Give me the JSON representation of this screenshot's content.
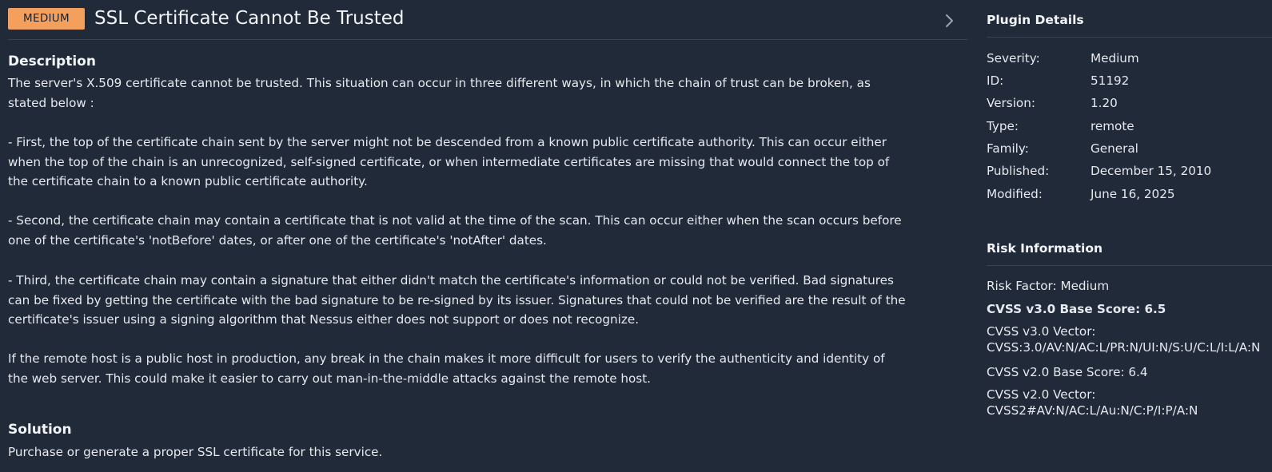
{
  "header": {
    "severity_badge": "MEDIUM",
    "title": "SSL Certificate Cannot Be Trusted",
    "colors": {
      "background": "#212a38",
      "badge": "#f3a05e",
      "divider": "#3a4454"
    },
    "next_icon": "chevron-right-icon"
  },
  "description": {
    "heading": "Description",
    "paragraphs": [
      "The server's X.509 certificate cannot be trusted. This situation can occur in three different ways, in which the chain of trust can be broken, as stated below :",
      "- First, the top of the certificate chain sent by the server might not be descended from a known public certificate authority. This can occur either when the top of the chain is an unrecognized, self-signed certificate, or when intermediate certificates are missing that would connect the top of the certificate chain to a known public certificate authority.",
      "- Second, the certificate chain may contain a certificate that is not valid at the time of the scan. This can occur either when the scan occurs before one of the certificate's 'notBefore' dates, or after one of the certificate's 'notAfter' dates.",
      "- Third, the certificate chain may contain a signature that either didn't match the certificate's information or could not be verified. Bad signatures can be fixed by getting the certificate with the bad signature to be re-signed by its issuer. Signatures that could not be verified are the result of the certificate's issuer using a signing algorithm that Nessus either does not support or does not recognize.",
      "If the remote host is a public host in production, any break in the chain makes it more difficult for users to verify the authenticity and identity of the web server. This could make it easier to carry out man-in-the-middle attacks against the remote host."
    ]
  },
  "solution": {
    "heading": "Solution",
    "text": "Purchase or generate a proper SSL certificate for this service."
  },
  "plugin_details": {
    "heading": "Plugin Details",
    "rows": [
      {
        "label": "Severity:",
        "value": "Medium"
      },
      {
        "label": "ID:",
        "value": "51192"
      },
      {
        "label": "Version:",
        "value": "1.20"
      },
      {
        "label": "Type:",
        "value": "remote"
      },
      {
        "label": "Family:",
        "value": "General"
      },
      {
        "label": "Published:",
        "value": "December 15, 2010"
      },
      {
        "label": "Modified:",
        "value": "June 16, 2025"
      }
    ]
  },
  "risk_information": {
    "heading": "Risk Information",
    "risk_factor": "Risk Factor: Medium",
    "cvss3_base_score": "CVSS v3.0 Base Score: 6.5",
    "cvss3_vector_label": "CVSS v3.0 Vector:",
    "cvss3_vector": "CVSS:3.0/AV:N/AC:L/PR:N/UI:N/S:U/C:L/I:L/A:N",
    "cvss2_base_score": "CVSS v2.0 Base Score: 6.4",
    "cvss2_vector_label": "CVSS v2.0 Vector:",
    "cvss2_vector": "CVSS2#AV:N/AC:L/Au:N/C:P/I:P/A:N"
  }
}
